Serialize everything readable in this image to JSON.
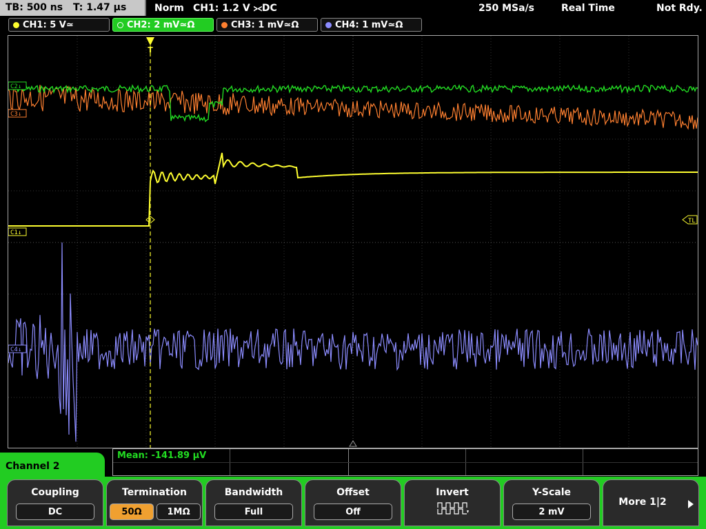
{
  "topbar": {
    "timebase": "TB: 500 ns",
    "trigger_time": "T: 1.47 µs",
    "mode": "Norm",
    "trigger_src": "CH1: 1.2 V ⪥DC",
    "sample_rate": "250 MSa/s",
    "acq": "Real Time",
    "state": "Not Rdy."
  },
  "channels": [
    {
      "label": "CH1: 5 V≃",
      "color": "#ffff30"
    },
    {
      "label": "CH2: 2 mV≃Ω",
      "color": "#22dd22"
    },
    {
      "label": "CH3: 1 mV≃Ω",
      "color": "#ff8030"
    },
    {
      "label": "CH4: 1 mV≃Ω",
      "color": "#8c8cff"
    }
  ],
  "markers": {
    "c1": "C1↓",
    "c2": "C2↓",
    "c3": "C3↓",
    "c4": "C4↓",
    "tl": "TL",
    "trig": "T"
  },
  "measurement": {
    "mean": "Mean: -141.89 µV"
  },
  "menu": {
    "title": "Channel 2",
    "coupling_label": "Coupling",
    "coupling_value": "DC",
    "termination_label": "Termination",
    "term_50": "50Ω",
    "term_1m": "1MΩ",
    "bandwidth_label": "Bandwidth",
    "bandwidth_value": "Full",
    "offset_label": "Offset",
    "offset_value": "Off",
    "invert_label": "Invert",
    "yscale_label": "Y-Scale",
    "yscale_value": "2 mV",
    "more_label": "More 1|2"
  }
}
